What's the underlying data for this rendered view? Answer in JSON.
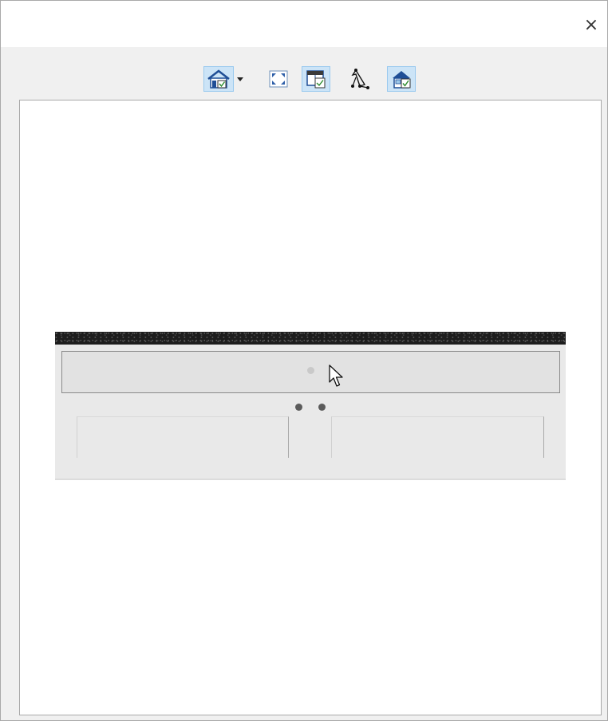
{
  "window": {
    "close_label": "×"
  },
  "toolbar": {
    "tools": [
      {
        "name": "view-mode-icon",
        "active": true,
        "has_dropdown": true
      },
      {
        "name": "fill-window-icon",
        "active": false
      },
      {
        "name": "elevation-view-icon",
        "active": true
      },
      {
        "name": "edit-handles-icon",
        "active": false
      },
      {
        "name": "render-3d-icon",
        "active": true
      }
    ]
  },
  "colors": {
    "active_tool_bg": "#cce4f7",
    "active_tool_border": "#99c9ef",
    "icon_blue": "#1f4e96",
    "countertop": "#1d1d1d",
    "cabinet": "#e9e9e9"
  }
}
